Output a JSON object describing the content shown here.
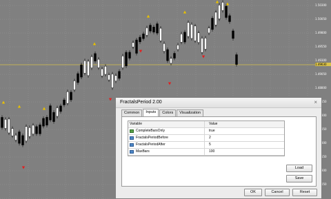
{
  "price_axis": [
    "1.50300",
    "1.50050",
    "1.49800",
    "1.49550",
    "1.49300",
    "1.49050",
    "1.48800",
    "1.48550",
    "1.48300",
    "1.48050",
    "1.47800",
    "1.47550",
    "1.47300",
    "1.47050"
  ],
  "price_highlight": "1.49630",
  "dialog": {
    "title": "FractalsPeriod 2.00",
    "close_glyph": "×",
    "tabs": [
      "Common",
      "Inputs",
      "Colors",
      "Visualization"
    ],
    "active_tab": 1,
    "table": {
      "headers": [
        "Variable",
        "Value"
      ],
      "rows": [
        {
          "name": "CompleteBarsOnly",
          "value": "true",
          "icon": "bool-icon"
        },
        {
          "name": "FractalsPeriodBefore",
          "value": "2",
          "icon": "number-icon"
        },
        {
          "name": "FractalsPeriodAfter",
          "value": "5",
          "icon": "number-icon"
        },
        {
          "name": "MaxBars",
          "value": "100",
          "icon": "number-icon"
        }
      ]
    },
    "buttons": {
      "load": "Load",
      "save": "Save",
      "ok": "OK",
      "cancel": "Cancel",
      "reset": "Reset"
    }
  },
  "colors": {
    "background": "#808080",
    "bull": "#ffffff",
    "bear": "#000000",
    "up_fractal": "#e8c000",
    "down_fractal": "#e02020",
    "price_line": "#d9c24a"
  }
}
